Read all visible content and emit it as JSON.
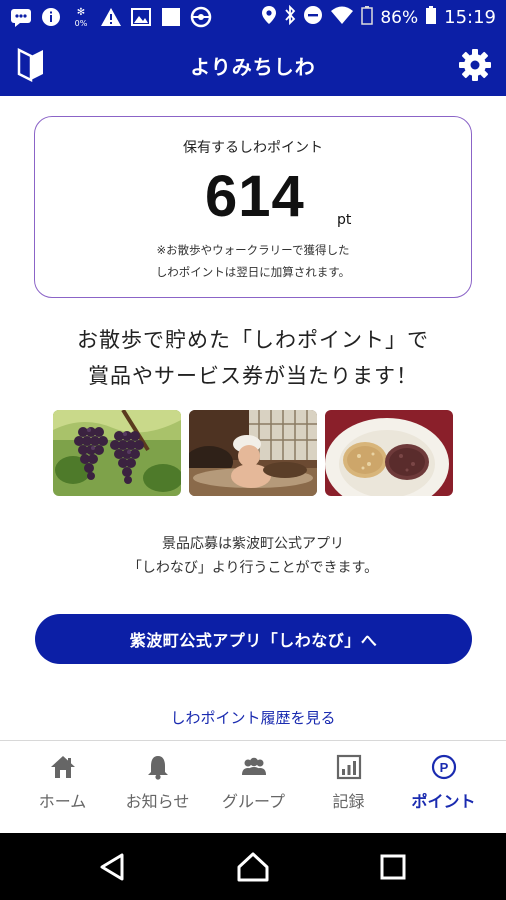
{
  "status_bar": {
    "battery_percent": "86%",
    "time": "15:19",
    "icons": [
      "chat-icon",
      "info-icon",
      "data-icon",
      "warning-icon",
      "image-icon",
      "square-icon",
      "sync-icon",
      "location-icon",
      "bluetooth-icon",
      "dnd-icon",
      "wifi-icon",
      "battery-outline-icon",
      "battery-icon"
    ]
  },
  "app_bar": {
    "title": "よりみちしわ",
    "left_icon": "beginner-mark-icon",
    "right_icon": "gear-icon",
    "color": "#0c1fa6"
  },
  "points_card": {
    "label": "保有するしわポイント",
    "value": "614",
    "unit": "pt",
    "note_line1": "※お散歩やウォークラリーで獲得した",
    "note_line2": "しわポイントは翌日に加算されます。",
    "border_color": "#8b64c7"
  },
  "headline": {
    "line1": "お散歩で貯めた「しわポイント」で",
    "line2": "賞品やサービス券が当たります！"
  },
  "photos": [
    "grapes-photo",
    "hot-spring-photo",
    "sweets-photo"
  ],
  "info": {
    "line1": "景品応募は紫波町公式アプリ",
    "line2": "「しわなび」より行うことができます。"
  },
  "cta_button": {
    "label": "紫波町公式アプリ「しわなび」へ"
  },
  "history_link": {
    "label": "しわポイント履歴を見る"
  },
  "bottom_nav": {
    "items": [
      {
        "label": "ホーム",
        "icon": "home-icon",
        "active": false
      },
      {
        "label": "お知らせ",
        "icon": "bell-icon",
        "active": false
      },
      {
        "label": "グループ",
        "icon": "group-icon",
        "active": false
      },
      {
        "label": "記録",
        "icon": "chart-icon",
        "active": false
      },
      {
        "label": "ポイント",
        "icon": "point-icon",
        "active": true
      }
    ],
    "active_color": "#1a2bb0"
  },
  "system_nav": {
    "icons": [
      "back-icon",
      "home-circle-icon",
      "recents-icon"
    ]
  }
}
